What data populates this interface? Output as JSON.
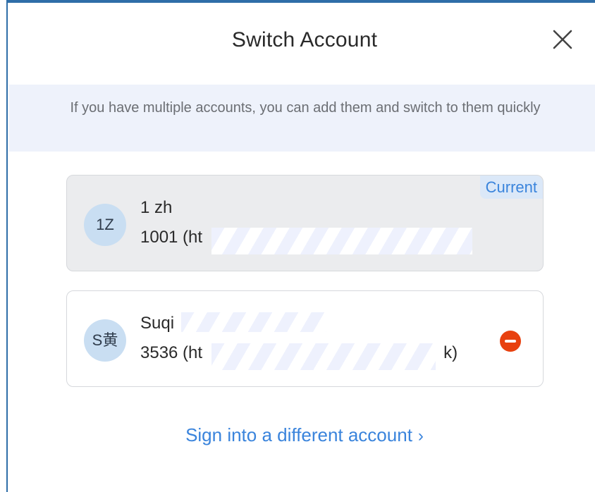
{
  "dialog": {
    "title": "Switch Account",
    "close_icon": "close-icon",
    "info": "If you have multiple accounts, you can add them and switch to them quickly"
  },
  "accounts": [
    {
      "avatar": "1Z",
      "name": "1 zh",
      "detail": "1001 (ht",
      "badge": "Current",
      "is_current": true
    },
    {
      "avatar": "S黄",
      "name": "Suqi",
      "detail": "3536 (ht",
      "detail_end": "k)",
      "remove_icon": "remove-circle-icon",
      "is_current": false
    }
  ],
  "signin": {
    "label": "Sign into a different account",
    "chevron": "›"
  },
  "colors": {
    "accent": "#3a84dc",
    "banner_bg": "#eef2fb",
    "remove": "#e8410f",
    "avatar_bg": "#c9def2"
  }
}
